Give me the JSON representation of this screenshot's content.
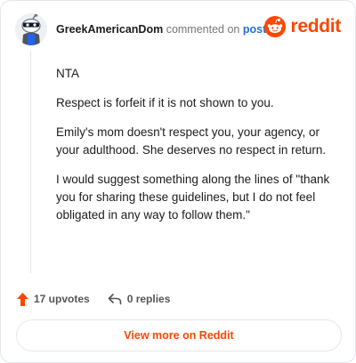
{
  "header": {
    "username": "GreekAmericanDom",
    "commented_on": "commented on",
    "post_link": "post",
    "brand": "reddit"
  },
  "comment": {
    "paragraphs": [
      "NTA",
      "Respect is forfeit if it is not shown to you.",
      "Emily's mom doesn't respect you, your agency, or your adulthood. She deserves no respect in return.",
      "I would suggest something along the lines of \"thank you for sharing these guidelines, but I do not feel obligated in any way to follow them.\""
    ]
  },
  "actions": {
    "upvotes": "17 upvotes",
    "replies": "0 replies"
  },
  "footer": {
    "view_more": "View more on Reddit"
  },
  "colors": {
    "accent": "#ff4500",
    "link": "#1e6fd9"
  },
  "icons": [
    "avatar-snoo-icon",
    "reddit-logo-icon",
    "upvote-arrow-icon",
    "reply-icon"
  ]
}
